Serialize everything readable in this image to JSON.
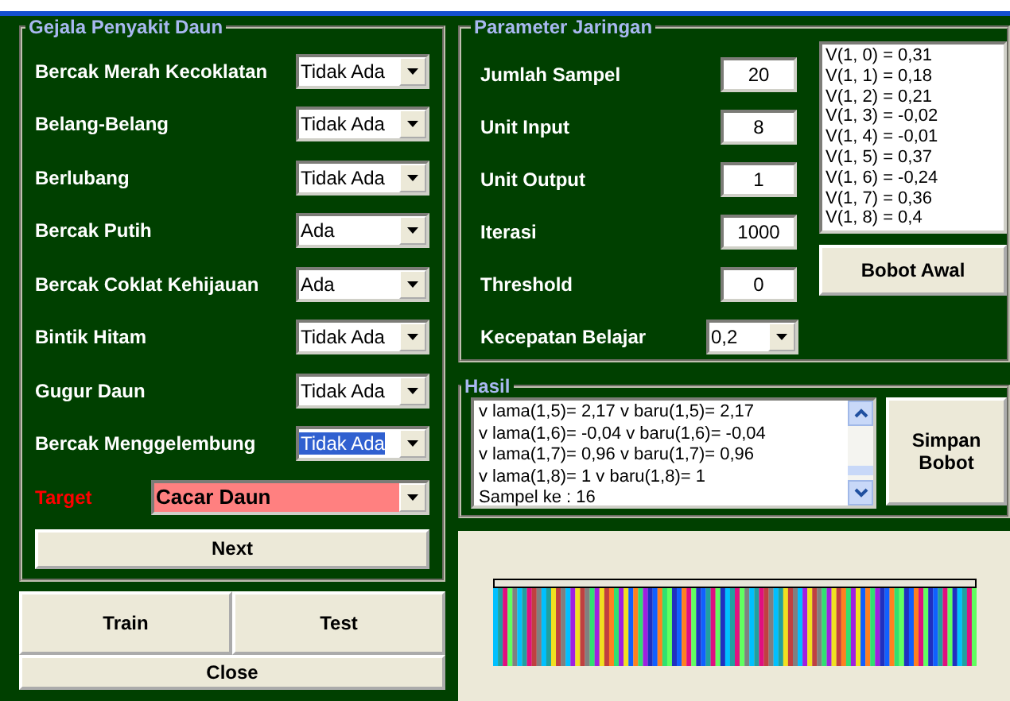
{
  "symptoms": {
    "title": "Gejala Penyakit Daun",
    "items": [
      {
        "label": "Bercak Merah Kecoklatan",
        "value": "Tidak Ada",
        "text_selected": false
      },
      {
        "label": "Belang-Belang",
        "value": "Tidak Ada",
        "text_selected": false
      },
      {
        "label": "Berlubang",
        "value": "Tidak Ada",
        "text_selected": false
      },
      {
        "label": "Bercak Putih",
        "value": "Ada",
        "text_selected": false
      },
      {
        "label": "Bercak Coklat Kehijauan",
        "value": "Ada",
        "text_selected": false
      },
      {
        "label": "Bintik Hitam",
        "value": "Tidak Ada",
        "text_selected": false
      },
      {
        "label": "Gugur Daun",
        "value": "Tidak Ada",
        "text_selected": false
      },
      {
        "label": "Bercak Menggelembung",
        "value": "Tidak Ada",
        "text_selected": true
      }
    ],
    "target": {
      "label": "Target",
      "value": "Cacar Daun"
    },
    "next_button": "Next"
  },
  "buttons": [
    "Train",
    "Test",
    "Close"
  ],
  "parameters": {
    "title": "Parameter Jaringan",
    "fields": [
      {
        "label": "Jumlah Sampel",
        "value": "20",
        "kind": "input"
      },
      {
        "label": "Unit Input",
        "value": "8",
        "kind": "input"
      },
      {
        "label": "Unit Output",
        "value": "1",
        "kind": "input"
      },
      {
        "label": "Iterasi",
        "value": "1000",
        "kind": "input"
      },
      {
        "label": "Threshold",
        "value": "0",
        "kind": "input"
      },
      {
        "label": "Kecepatan Belajar",
        "value": "0,2",
        "kind": "dropdown"
      }
    ],
    "weights": [
      "V(1, 0) = 0,31",
      "V(1, 1) = 0,18",
      "V(1, 2) = 0,21",
      "V(1, 3) = -0,02",
      "V(1, 4) = -0,01",
      "V(1, 5) = 0,37",
      "V(1, 6) = -0,24",
      "V(1, 7) = 0,36",
      "V(1, 8) = 0,4"
    ],
    "button": "Bobot Awal"
  },
  "result": {
    "title": "Hasil",
    "lines": [
      "v lama(1,5)= 2,17 v baru(1,5)= 2,17",
      "v lama(1,6)= -0,04 v baru(1,6)= -0,04",
      "v lama(1,7)= 0,96 v baru(1,7)= 0,96",
      "v lama(1,8)= 1 v baru(1,8)= 1",
      "Sampel ke : 16"
    ],
    "button": "Simpan Bobot"
  }
}
